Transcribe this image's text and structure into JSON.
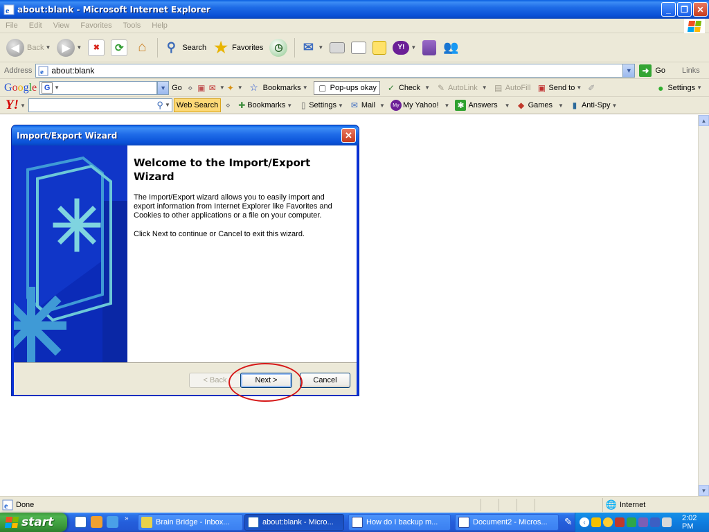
{
  "window": {
    "title": "about:blank - Microsoft Internet Explorer"
  },
  "menu": [
    "File",
    "Edit",
    "View",
    "Favorites",
    "Tools",
    "Help"
  ],
  "toolbar": {
    "back": "Back",
    "search": "Search",
    "favorites": "Favorites"
  },
  "address": {
    "label": "Address",
    "value": "about:blank",
    "go": "Go",
    "links": "Links"
  },
  "google_toolbar": {
    "logo": "Google",
    "input_badge": "G",
    "go": "Go",
    "bookmarks": "Bookmarks",
    "popups": "Pop-ups okay",
    "check": "Check",
    "autolink": "AutoLink",
    "autofill": "AutoFill",
    "send_to": "Send to",
    "settings": "Settings"
  },
  "yahoo_toolbar": {
    "logo": "Y!",
    "web_search": "Web Search",
    "bookmarks": "Bookmarks",
    "settings": "Settings",
    "mail": "Mail",
    "my_yahoo": "My Yahoo!",
    "answers": "Answers",
    "games": "Games",
    "anti_spy": "Anti-Spy"
  },
  "dialog": {
    "title": "Import/Export Wizard",
    "heading": "Welcome to the Import/Export Wizard",
    "paragraph1": "The Import/Export wizard allows you to easily import and export information from Internet Explorer like Favorites and Cookies to other applications or a file on your computer.",
    "paragraph2": "Click Next to continue or Cancel to exit this wizard.",
    "back": "< Back",
    "next": "Next >",
    "cancel": "Cancel"
  },
  "status": {
    "text": "Done",
    "zone": "Internet"
  },
  "taskbar": {
    "start": "start",
    "tasks": [
      "Brain Bridge - Inbox...",
      "about:blank - Micro...",
      "How do I backup m...",
      "Document2 - Micros..."
    ],
    "clock": "2:02 PM"
  },
  "colors": {
    "xp_blue": "#0a5fe0",
    "start_green": "#3c9a3c",
    "annotation_red": "#d61818",
    "wizard_blue": "#0a2ab5"
  }
}
